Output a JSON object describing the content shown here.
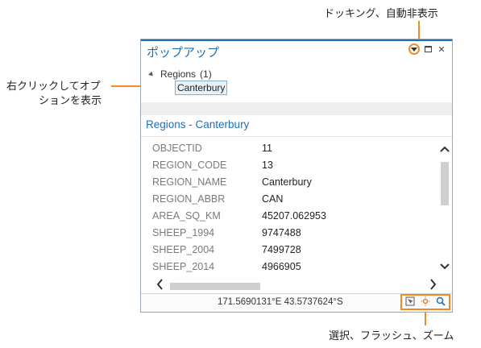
{
  "callouts": {
    "docking": "ドッキング、自動非表示",
    "right_click_line1": "右クリックしてオプ",
    "right_click_line2": "ションを表示",
    "tools": "選択、フラッシュ、ズーム"
  },
  "panel": {
    "title": "ポップアップ",
    "tree_layer": "Regions",
    "tree_count": "(1)",
    "selected_feature": "Canterbury",
    "feature_header": "Regions - Canterbury",
    "attributes": [
      {
        "key": "OBJECTID",
        "value": "11"
      },
      {
        "key": "REGION_CODE",
        "value": "13"
      },
      {
        "key": "REGION_NAME",
        "value": "Canterbury"
      },
      {
        "key": "REGION_ABBR",
        "value": "CAN"
      },
      {
        "key": "AREA_SQ_KM",
        "value": "45207.062953"
      },
      {
        "key": "SHEEP_1994",
        "value": "9747488"
      },
      {
        "key": "SHEEP_2004",
        "value": "7499728"
      },
      {
        "key": "SHEEP_2014",
        "value": "4966905"
      }
    ],
    "coordinates": "171.5690131°E 43.5737624°S"
  },
  "colors": {
    "accent": "#1f6fb5",
    "callout": "#f08a24"
  },
  "icons": {
    "dock": "dock-menu-icon",
    "maximize": "maximize-icon",
    "close": "close-icon",
    "select": "select-icon",
    "flash": "flash-icon",
    "zoom": "zoom-icon"
  }
}
